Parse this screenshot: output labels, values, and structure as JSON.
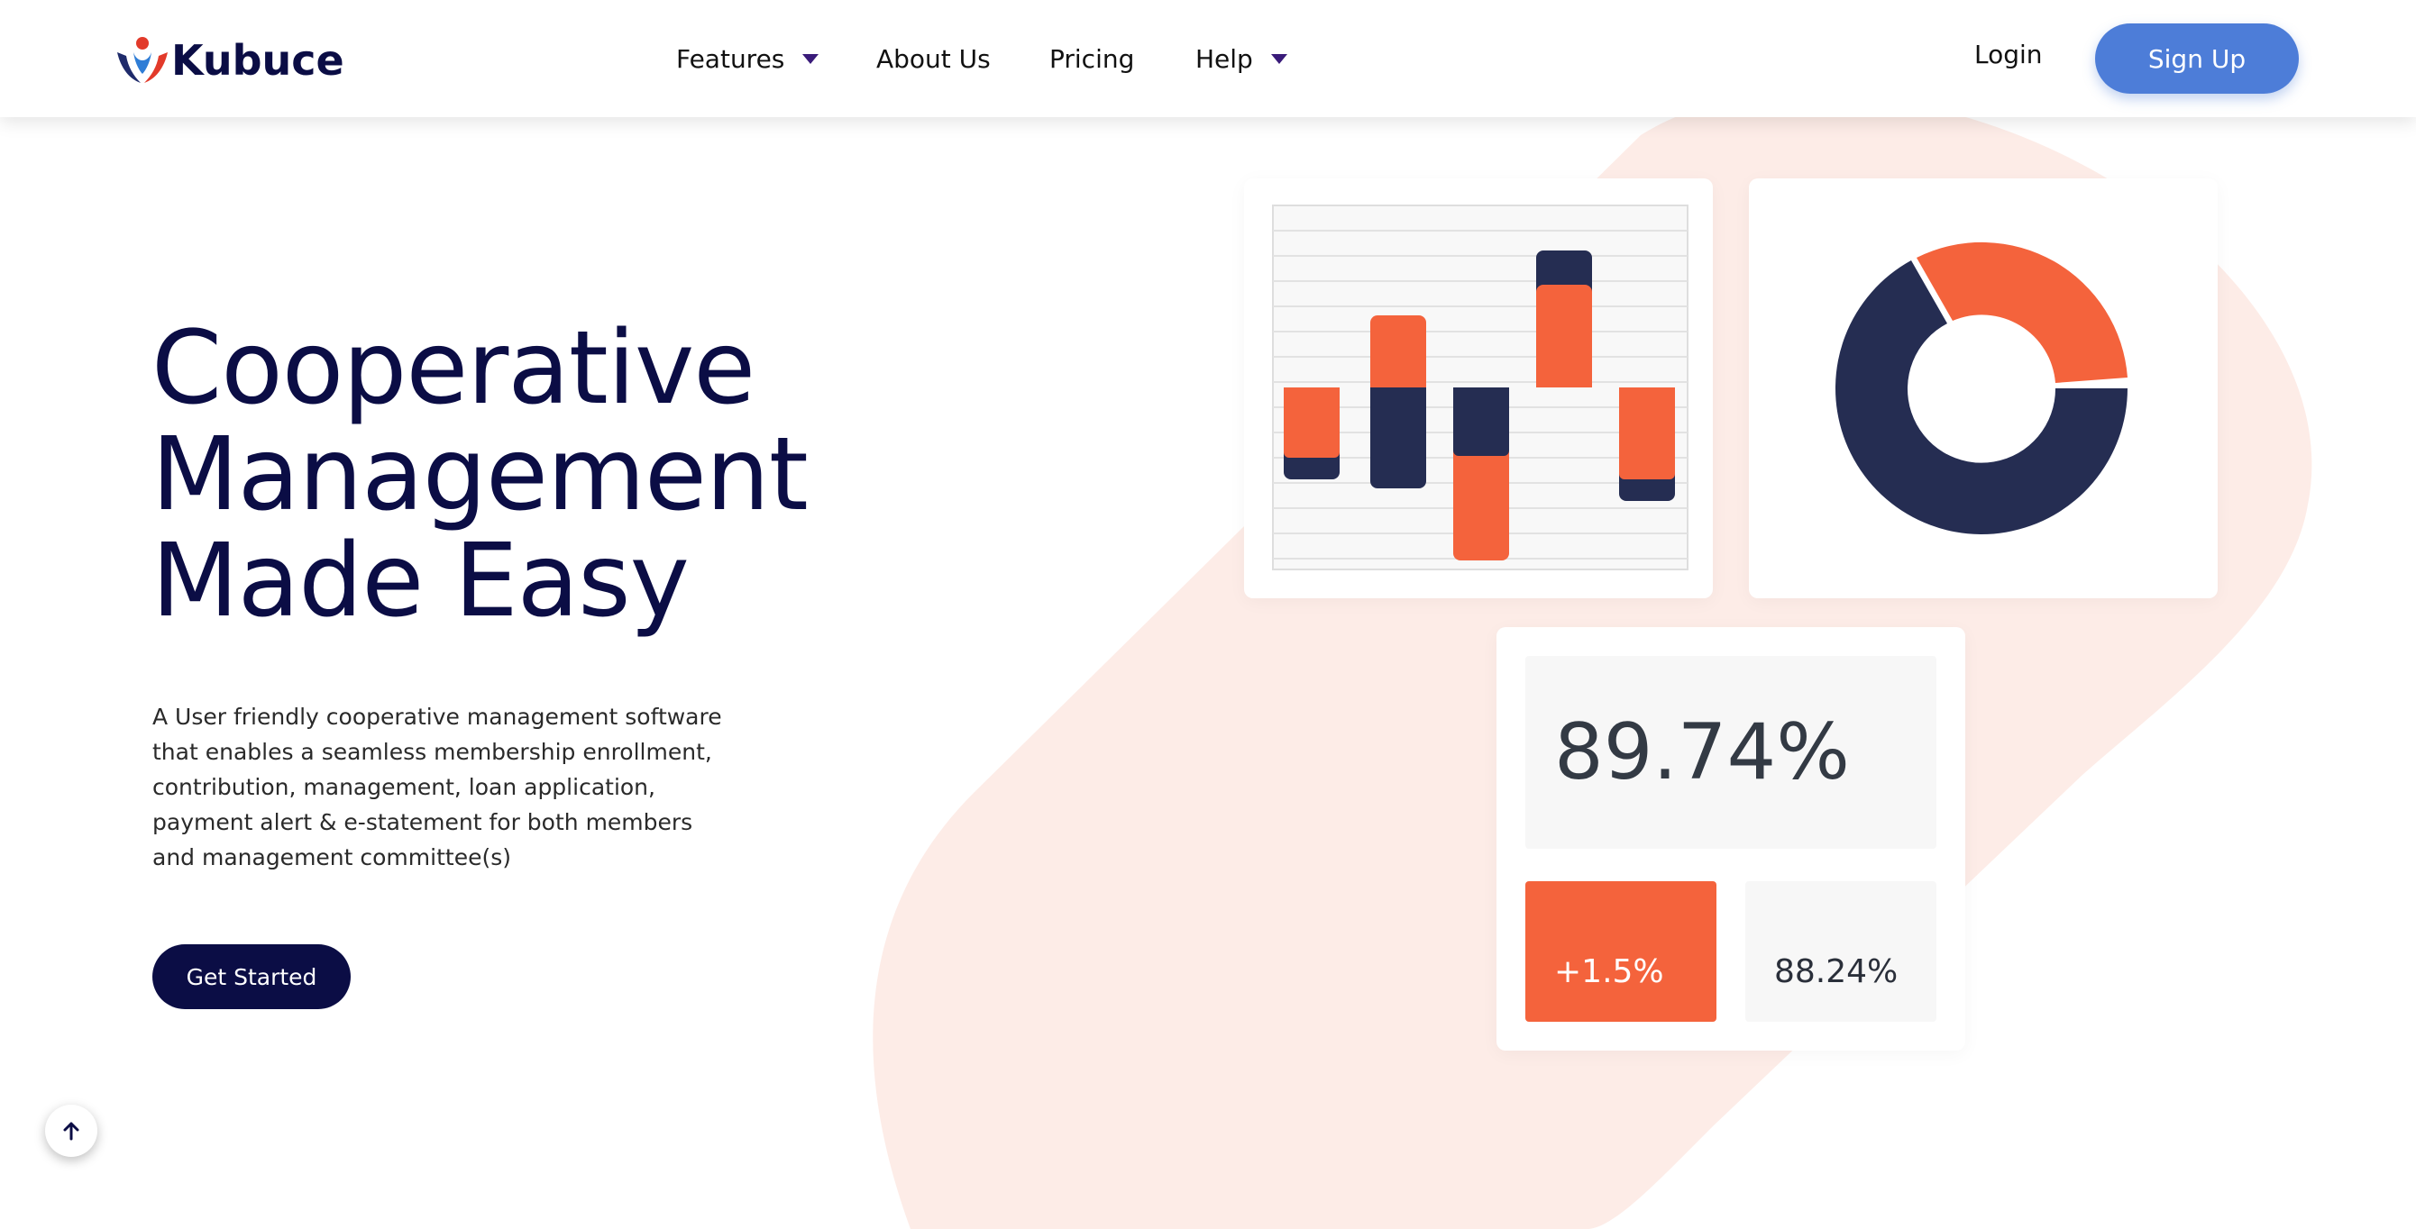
{
  "brand": {
    "name": "Kubuce",
    "colors": {
      "navy": "#0b0d45",
      "orange": "#f4633c",
      "blue": "#4d7dd8",
      "dark_slate": "#252d52"
    }
  },
  "nav": {
    "items": [
      {
        "label": "Features",
        "has_dropdown": true
      },
      {
        "label": "About Us",
        "has_dropdown": false
      },
      {
        "label": "Pricing",
        "has_dropdown": false
      },
      {
        "label": "Help",
        "has_dropdown": true
      }
    ],
    "login_label": "Login",
    "signup_label": "Sign Up"
  },
  "hero": {
    "title_lines": [
      "Cooperative",
      "Management",
      "Made Easy"
    ],
    "description": "A User friendly cooperative management software that enables a seamless membership enrollment, contribution, management, loan application, payment alert & e-statement for both members and management committee(s)",
    "cta_label": "Get Started"
  },
  "stats": {
    "main_value": "89.74%",
    "delta_value": "+1.5%",
    "alt_value": "88.24%"
  },
  "scroll_top": {
    "icon": "arrow-up-icon"
  }
}
